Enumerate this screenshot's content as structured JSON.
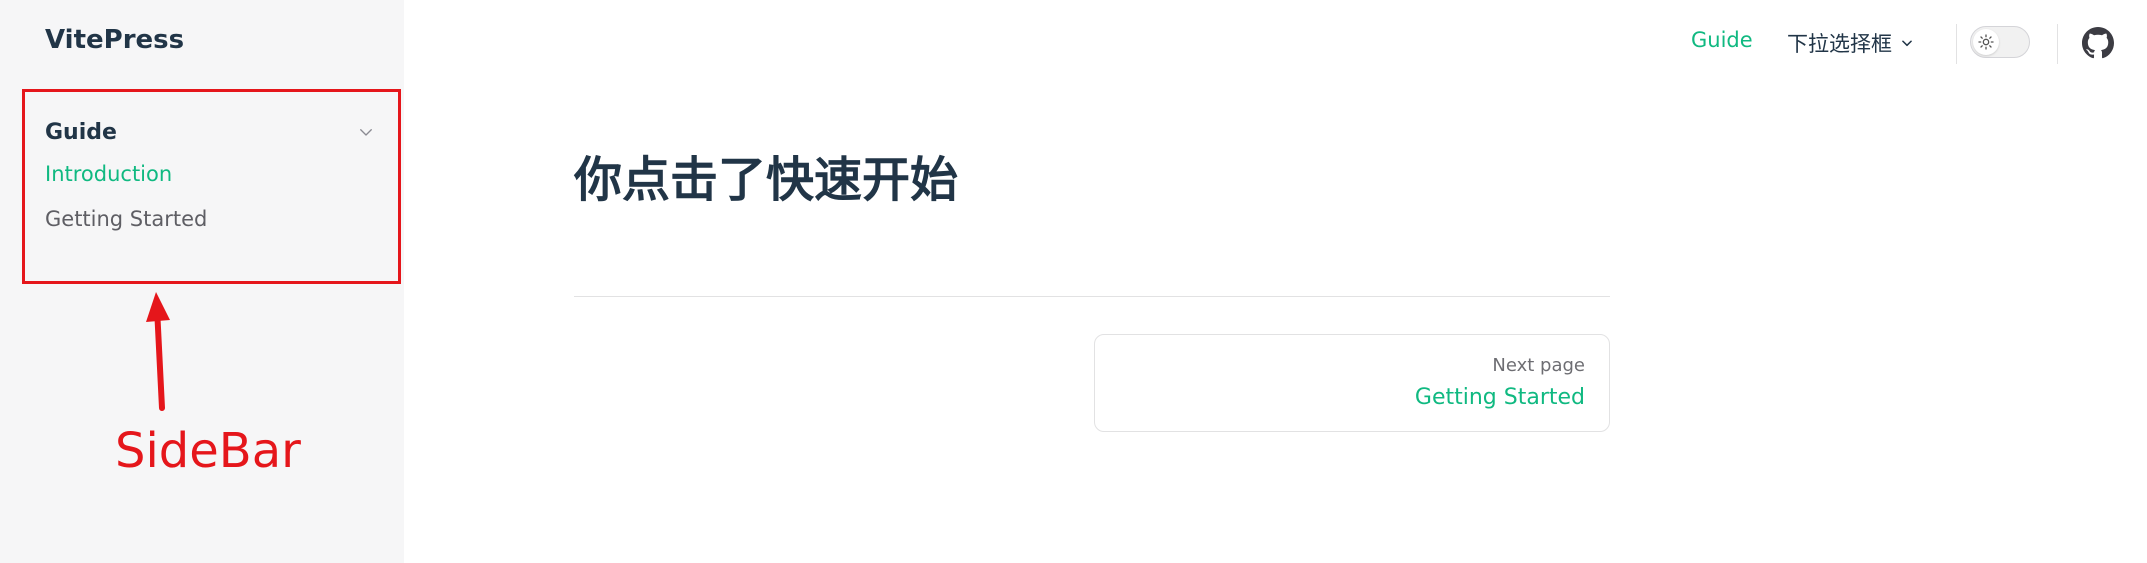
{
  "sidebar": {
    "site_title": "VitePress",
    "group": {
      "title": "Guide",
      "items": [
        {
          "label": "Introduction",
          "active": true
        },
        {
          "label": "Getting Started",
          "active": false
        }
      ]
    }
  },
  "annotation": {
    "label": "SideBar",
    "color": "#e5161b"
  },
  "navbar": {
    "links": [
      {
        "label": "Guide",
        "active": true
      },
      {
        "label": "下拉选择框",
        "has_dropdown": true
      }
    ],
    "theme_toggle_icon": "sun-icon",
    "github_icon": "github-icon"
  },
  "content": {
    "title": "你点击了快速开始",
    "next_page": {
      "desc": "Next page",
      "title": "Getting Started"
    }
  },
  "colors": {
    "accent": "#10b981",
    "sidebar_bg": "#f6f6f7",
    "text": "#213547"
  }
}
